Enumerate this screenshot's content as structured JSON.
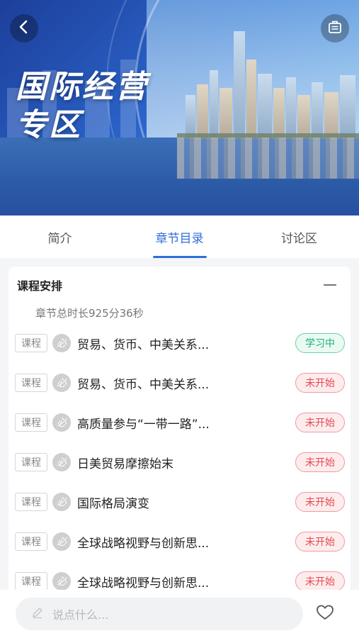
{
  "banner": {
    "title_line1": "国际经营",
    "title_line2": "专区"
  },
  "icons": {
    "back": "chevron-left-icon",
    "share": "clipboard-icon",
    "compulsory": "compulsory-icon",
    "comment": "pencil-icon",
    "like": "heart-icon"
  },
  "tabs": [
    {
      "label": "简介"
    },
    {
      "label": "章节目录"
    },
    {
      "label": "讨论区"
    }
  ],
  "course": {
    "section_title": "课程安排",
    "duration": "章节总时长925分36秒",
    "items": [
      {
        "tag": "课程",
        "req": "必",
        "title": "贸易、货币、中美关系...",
        "status": "学习中"
      },
      {
        "tag": "课程",
        "req": "必",
        "title": "贸易、货币、中美关系...",
        "status": "未开始"
      },
      {
        "tag": "课程",
        "req": "必",
        "title": "高质量参与“一带一路”...",
        "status": "未开始"
      },
      {
        "tag": "课程",
        "req": "必",
        "title": "日美贸易摩擦始末",
        "status": "未开始"
      },
      {
        "tag": "课程",
        "req": "必",
        "title": "国际格局演变",
        "status": "未开始"
      },
      {
        "tag": "课程",
        "req": "必",
        "title": "全球战略视野与创新思...",
        "status": "未开始"
      },
      {
        "tag": "课程",
        "req": "必",
        "title": "全球战略视野与创新思...",
        "status": "未开始"
      }
    ]
  },
  "comment_bar": {
    "placeholder": "说点什么..."
  },
  "colors": {
    "accent": "#2f6fd6",
    "learning": "#18b07a",
    "not_started": "#e5484d"
  }
}
